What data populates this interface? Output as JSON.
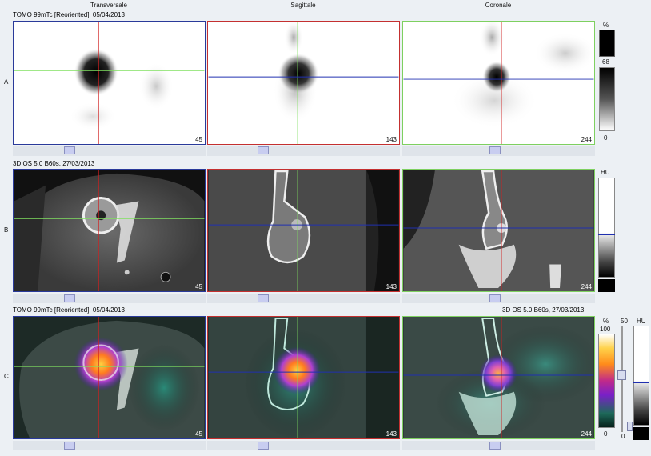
{
  "columns": [
    "Transversale",
    "Sagittale",
    "Coronale"
  ],
  "rows": [
    "A",
    "B",
    "C"
  ],
  "row_a": {
    "title": "TOMO 99mTc [Reoriented], 05/04/2013",
    "slices": [
      "45",
      "143",
      "244"
    ],
    "scale_unit": "%",
    "scale_max": "68",
    "scale_min": "0"
  },
  "row_b": {
    "title": "3D OS 5.0 B60s, 27/03/2013",
    "slices": [
      "45",
      "143",
      "244"
    ],
    "scale_unit": "HU"
  },
  "row_c": {
    "title_left": "TOMO 99mTc [Reoriented], 05/04/2013",
    "title_right": "3D OS 5.0 B60s, 27/03/2013",
    "slices": [
      "45",
      "143",
      "244"
    ],
    "scale_unit": "%",
    "scale_max": "100",
    "scale_min": "0",
    "blend_value": "50",
    "blend_min": "0",
    "hu_unit": "HU"
  },
  "colors": {
    "transversal_frame": "#2a3a9a",
    "sagittal_frame": "#c43030",
    "coronal_frame": "#7ed060",
    "cursor_red": "#d02020",
    "cursor_green": "#80e060",
    "cursor_blue": "#2030b0"
  }
}
